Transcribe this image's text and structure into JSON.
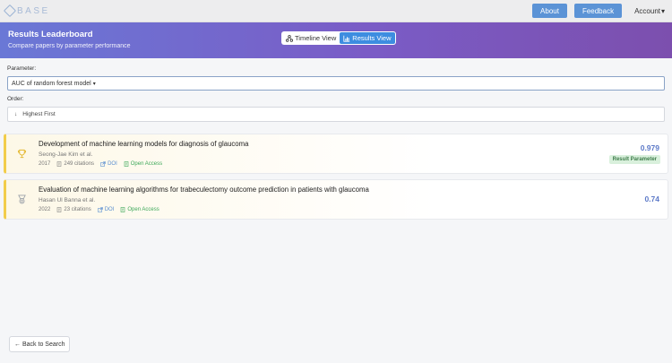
{
  "topbar": {
    "logo_text": "BASE",
    "about_label": "About",
    "feedback_label": "Feedback",
    "account_label": "Account"
  },
  "hero": {
    "title": "Results Leaderboard",
    "subtitle": "Compare papers by parameter performance",
    "timeline_label": "Timeline View",
    "results_label": "Results View"
  },
  "controls": {
    "parameter_label": "Parameter:",
    "parameter_value": "AUC of random forest model",
    "order_label": "Order:",
    "order_value": "Highest First"
  },
  "results": [
    {
      "title": "Development of machine learning models for diagnosis of glaucoma",
      "authors": "Seong-Jae Kim et al.",
      "year": "2017",
      "citations": "249 citations",
      "doi": "DOI",
      "open_access": "Open Access",
      "score": "0.979",
      "badge": "Result Parameter"
    },
    {
      "title": "Evaluation of machine learning algorithms for trabeculectomy outcome prediction in patients with glaucoma",
      "authors": "Hasan Ul Banna et al.",
      "year": "2022",
      "citations": "23 citations",
      "doi": "DOI",
      "open_access": "Open Access",
      "score": "0.74"
    }
  ],
  "footer": {
    "back_label": "Back to Search"
  }
}
